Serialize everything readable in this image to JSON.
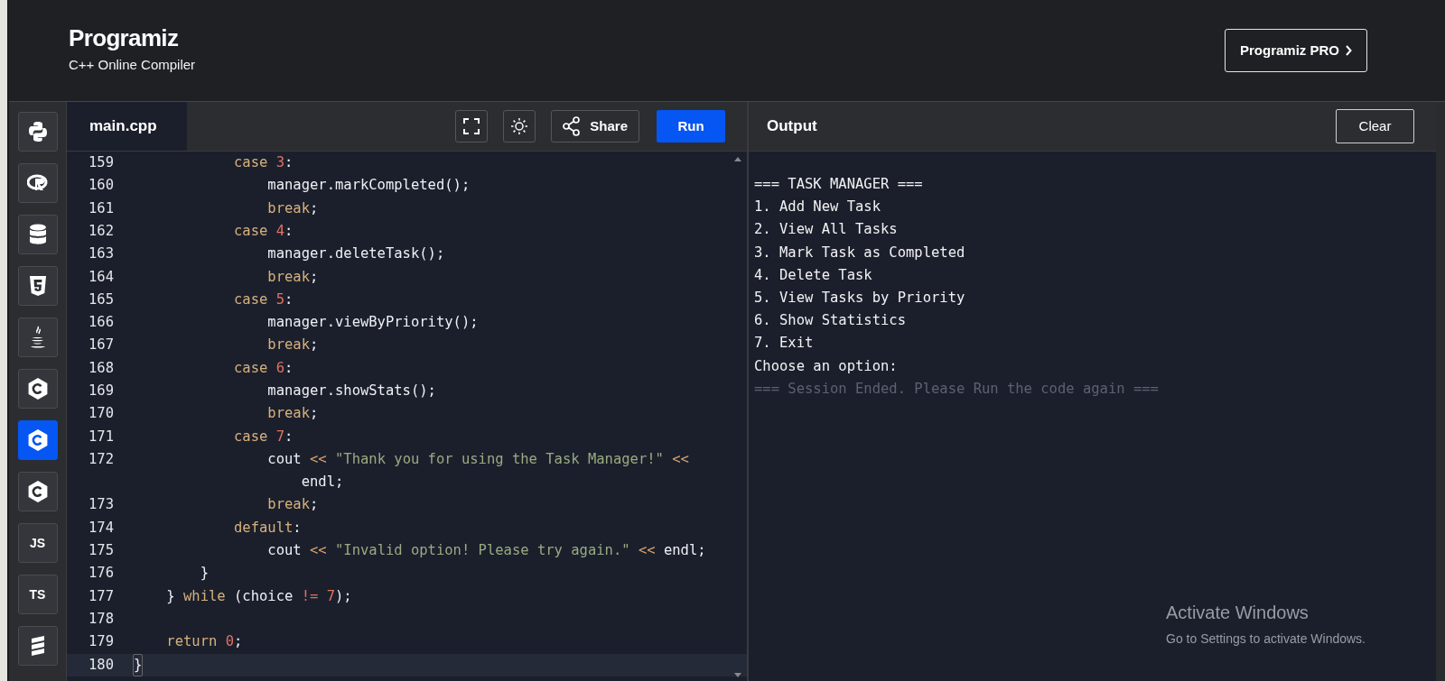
{
  "header": {
    "logo": "Programiz",
    "subtitle": "C++ Online Compiler",
    "pro_button": "Programiz PRO"
  },
  "sidebar": {
    "items": [
      {
        "kind": "python",
        "selected": false
      },
      {
        "kind": "r",
        "selected": false
      },
      {
        "kind": "database",
        "selected": false
      },
      {
        "kind": "html",
        "selected": false
      },
      {
        "kind": "java",
        "selected": false
      },
      {
        "kind": "c",
        "selected": false
      },
      {
        "kind": "cpp",
        "selected": true
      },
      {
        "kind": "csharp",
        "selected": false
      },
      {
        "kind": "text",
        "label": "JS",
        "selected": false
      },
      {
        "kind": "text",
        "label": "TS",
        "selected": false
      },
      {
        "kind": "stack",
        "selected": false
      }
    ]
  },
  "editor": {
    "tab": {
      "label": "main.cpp",
      "selected": true
    },
    "share_button": "Share",
    "run_button": "Run",
    "lines": [
      {
        "number": "159",
        "active": false,
        "tokens": [
          {
            "kind": "keyword",
            "text": "            case "
          },
          {
            "kind": "number",
            "text": "3"
          },
          {
            "kind": "plain",
            "text": ":"
          }
        ]
      },
      {
        "number": "160",
        "active": false,
        "tokens": [
          {
            "kind": "plain",
            "text": "                manager.markCompleted();"
          }
        ]
      },
      {
        "number": "161",
        "active": false,
        "tokens": [
          {
            "kind": "keyword",
            "text": "                break"
          },
          {
            "kind": "plain",
            "text": ";"
          }
        ]
      },
      {
        "number": "162",
        "active": false,
        "tokens": [
          {
            "kind": "keyword",
            "text": "            case "
          },
          {
            "kind": "number",
            "text": "4"
          },
          {
            "kind": "plain",
            "text": ":"
          }
        ]
      },
      {
        "number": "163",
        "active": false,
        "tokens": [
          {
            "kind": "plain",
            "text": "                manager.deleteTask();"
          }
        ]
      },
      {
        "number": "164",
        "active": false,
        "tokens": [
          {
            "kind": "keyword",
            "text": "                break"
          },
          {
            "kind": "plain",
            "text": ";"
          }
        ]
      },
      {
        "number": "165",
        "active": false,
        "tokens": [
          {
            "kind": "keyword",
            "text": "            case "
          },
          {
            "kind": "number",
            "text": "5"
          },
          {
            "kind": "plain",
            "text": ":"
          }
        ]
      },
      {
        "number": "166",
        "active": false,
        "tokens": [
          {
            "kind": "plain",
            "text": "                manager.viewByPriority();"
          }
        ]
      },
      {
        "number": "167",
        "active": false,
        "tokens": [
          {
            "kind": "keyword",
            "text": "                break"
          },
          {
            "kind": "plain",
            "text": ";"
          }
        ]
      },
      {
        "number": "168",
        "active": false,
        "tokens": [
          {
            "kind": "keyword",
            "text": "            case "
          },
          {
            "kind": "number",
            "text": "6"
          },
          {
            "kind": "plain",
            "text": ":"
          }
        ]
      },
      {
        "number": "169",
        "active": false,
        "tokens": [
          {
            "kind": "plain",
            "text": "                manager.showStats();"
          }
        ]
      },
      {
        "number": "170",
        "active": false,
        "tokens": [
          {
            "kind": "keyword",
            "text": "                break"
          },
          {
            "kind": "plain",
            "text": ";"
          }
        ]
      },
      {
        "number": "171",
        "active": false,
        "tokens": [
          {
            "kind": "keyword",
            "text": "            case "
          },
          {
            "kind": "number",
            "text": "7"
          },
          {
            "kind": "plain",
            "text": ":"
          }
        ]
      },
      {
        "number": "172",
        "active": false,
        "tokens": [
          {
            "kind": "plain",
            "text": "                cout "
          },
          {
            "kind": "operator",
            "text": "<<"
          },
          {
            "kind": "string",
            "text": " \"Thank you for using the Task Manager!\" "
          },
          {
            "kind": "operator",
            "text": "<<"
          }
        ],
        "wrap": [
          {
            "kind": "plain",
            "text": "                    endl;"
          }
        ]
      },
      {
        "number": "173",
        "active": false,
        "tokens": [
          {
            "kind": "keyword",
            "text": "                break"
          },
          {
            "kind": "plain",
            "text": ";"
          }
        ]
      },
      {
        "number": "174",
        "active": false,
        "tokens": [
          {
            "kind": "keyword",
            "text": "            default"
          },
          {
            "kind": "plain",
            "text": ":"
          }
        ]
      },
      {
        "number": "175",
        "active": false,
        "tokens": [
          {
            "kind": "plain",
            "text": "                cout "
          },
          {
            "kind": "operator",
            "text": "<<"
          },
          {
            "kind": "string",
            "text": " \"Invalid option! Please try again.\" "
          },
          {
            "kind": "operator",
            "text": "<<"
          },
          {
            "kind": "plain",
            "text": " endl;"
          }
        ]
      },
      {
        "number": "176",
        "active": false,
        "tokens": [
          {
            "kind": "plain",
            "text": "        }"
          }
        ]
      },
      {
        "number": "177",
        "active": false,
        "tokens": [
          {
            "kind": "plain",
            "text": "    } "
          },
          {
            "kind": "keyword",
            "text": "while"
          },
          {
            "kind": "plain",
            "text": " (choice "
          },
          {
            "kind": "number",
            "text": "!= 7"
          },
          {
            "kind": "plain",
            "text": ");"
          }
        ]
      },
      {
        "number": "178",
        "active": false
      },
      {
        "number": "179",
        "active": false,
        "tokens": [
          {
            "kind": "keyword",
            "text": "    return "
          },
          {
            "kind": "number",
            "text": "0"
          },
          {
            "kind": "plain",
            "text": ";"
          }
        ]
      },
      {
        "number": "180",
        "active": true,
        "tokens": [
          {
            "kind": "plain",
            "text": "}"
          }
        ]
      }
    ]
  },
  "output": {
    "title": "Output",
    "clear_button": "Clear",
    "lines": [
      {
        "text": "=== TASK MANAGER ===",
        "muted": false
      },
      {
        "text": "1. Add New Task",
        "muted": false
      },
      {
        "text": "2. View All Tasks",
        "muted": false
      },
      {
        "text": "3. Mark Task as Completed",
        "muted": false
      },
      {
        "text": "4. Delete Task",
        "muted": false
      },
      {
        "text": "5. View Tasks by Priority",
        "muted": false
      },
      {
        "text": "6. Show Statistics",
        "muted": false
      },
      {
        "text": "7. Exit",
        "muted": false
      },
      {
        "text": "Choose an option:",
        "muted": false
      },
      {
        "text": "=== Session Ended. Please Run the code again ===",
        "muted": true
      }
    ]
  },
  "os_notice": {
    "title": "Activate Windows",
    "text": "Go to Settings to activate Windows."
  }
}
